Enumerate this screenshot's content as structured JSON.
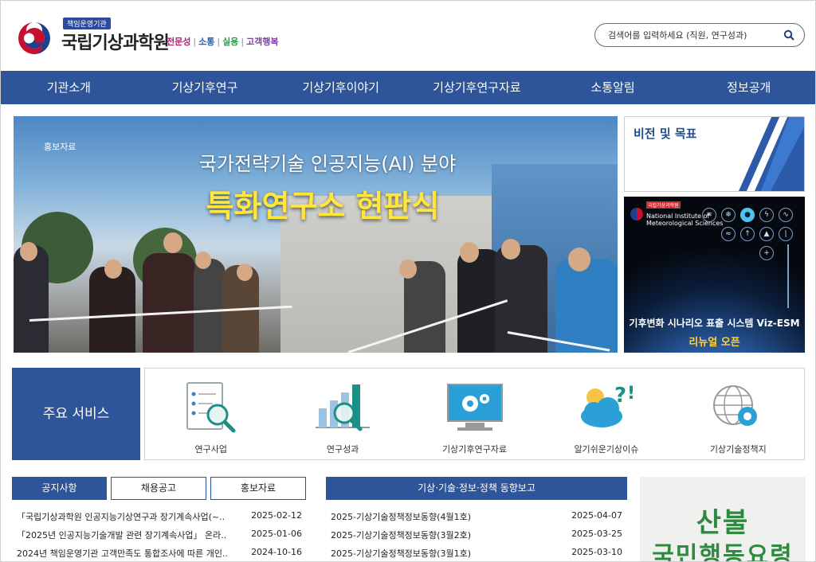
{
  "header": {
    "badge": "책임운영기관",
    "org_name": "국립기상과학원",
    "slogan": [
      "전문성",
      "소통",
      "실용",
      "고객행복"
    ],
    "search_placeholder": "검색어를 입력하세요 (직원, 연구성과)"
  },
  "nav": [
    "기관소개",
    "기상기후연구",
    "기상기후이야기",
    "기상기후연구자료",
    "소통알림",
    "정보공개"
  ],
  "hero": {
    "tag": "홍보자료",
    "line1": "국가전략기술 인공지능(AI) 분야",
    "line2": "특화연구소 현판식"
  },
  "vision": {
    "title": "비전 및 목표"
  },
  "esm": {
    "badge": "국립기상과학원",
    "org_en1": "National Institute of",
    "org_en2": "Meteorological Sciences",
    "title": "기후변화 시나리오 표출 시스템 Viz-ESM",
    "subtitle": "리뉴얼 오픈"
  },
  "services": {
    "label": "주요 서비스",
    "items": [
      "연구사업",
      "연구성과",
      "기상기후연구자료",
      "알기쉬운기상이슈",
      "기상기술정책지"
    ]
  },
  "notice": {
    "tabs": [
      "공지사항",
      "채용공고",
      "홍보자료"
    ],
    "rows": [
      {
        "title": "「국립기상과학원 인공지능기상연구과 장기계속사업(~..",
        "date": "2025-02-12"
      },
      {
        "title": "「2025년 인공지능기술개발 관련 장기계속사업」 온라..",
        "date": "2025-01-06"
      },
      {
        "title": "2024년 책임운영기관 고객만족도 통합조사에 따른 개인..",
        "date": "2024-10-16"
      }
    ]
  },
  "trend": {
    "title": "기상·기술·정보·정책 동향보고",
    "rows": [
      {
        "title": "2025-기상기술정책정보동향(4월1호)",
        "date": "2025-04-07"
      },
      {
        "title": "2025-기상기술정책정보동향(3월2호)",
        "date": "2025-03-25"
      },
      {
        "title": "2025-기상기술정책정보동향(3월1호)",
        "date": "2025-03-10"
      }
    ]
  },
  "banner": {
    "line1": "산불",
    "line2": "국민행동요령"
  },
  "colors": {
    "primary": "#2e5599",
    "accent_yellow": "#ffe63b"
  }
}
